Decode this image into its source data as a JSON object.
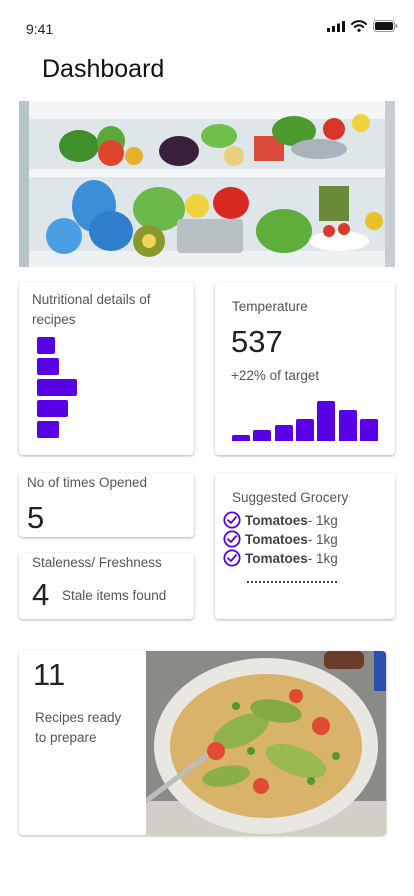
{
  "status": {
    "time": "9:41"
  },
  "header": {
    "title": "Dashboard"
  },
  "nutrition": {
    "label": "Nutritional details of recipes",
    "bars": [
      0.45,
      0.55,
      1.0,
      0.78,
      0.55
    ]
  },
  "temperature": {
    "label": "Temperature",
    "value": "537",
    "delta": "+22% of target",
    "bars": [
      0.16,
      0.28,
      0.4,
      0.55,
      1.0,
      0.78,
      0.55
    ]
  },
  "opened": {
    "label": "No of times Opened",
    "value": "5"
  },
  "staleness": {
    "label": "Staleness/ Freshness",
    "value": "4",
    "note": "Stale items found"
  },
  "grocery": {
    "label": "Suggested Grocery",
    "items": [
      {
        "name": "Tomatoes",
        "qty": " - 1kg"
      },
      {
        "name": "Tomatoes",
        "qty": " - 1kg"
      },
      {
        "name": "Tomatoes",
        "qty": " - 1kg"
      }
    ]
  },
  "recipes": {
    "value": "11",
    "label": "Recipes ready to prepare"
  },
  "colors": {
    "accent": "#5800e6"
  }
}
